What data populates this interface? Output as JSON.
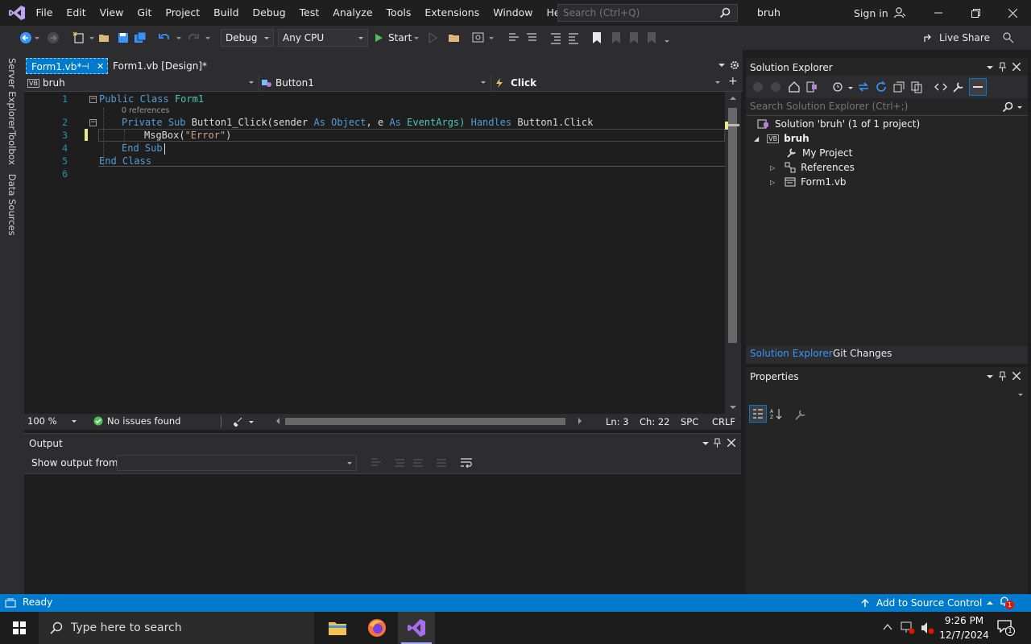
{
  "colors": {
    "accent": "#007acc",
    "editor_bg": "#1e1e1e",
    "chrome_bg": "#2d2d30",
    "keyword": "#569cd6",
    "type": "#4ec9b0",
    "string": "#d69d85",
    "line_number": "#2b91af"
  },
  "menu": [
    "File",
    "Edit",
    "View",
    "Git",
    "Project",
    "Build",
    "Debug",
    "Test",
    "Analyze",
    "Tools",
    "Extensions",
    "Window",
    "Help"
  ],
  "search": {
    "placeholder": "Search (Ctrl+Q)"
  },
  "solution_name": "bruh",
  "sign_in": "Sign in",
  "toolbar": {
    "config": "Debug",
    "platform": "Any CPU",
    "start": "Start",
    "live_share": "Live Share"
  },
  "side_tabs": [
    "Server Explorer",
    "Toolbox",
    "Data Sources"
  ],
  "doc_tabs": [
    {
      "label": "Form1.vb*",
      "pin": "⊣",
      "close": "✕"
    },
    {
      "label": "Form1.vb [Design]*"
    }
  ],
  "nav": {
    "project": "bruh",
    "object": "Button1",
    "event": "Click",
    "vb_badge": "VB"
  },
  "code": {
    "line_numbers": [
      "1",
      "2",
      "3",
      "4",
      "5",
      "6"
    ],
    "line1": {
      "kw1": "Public",
      "kw2": "Class",
      "name": "Form1"
    },
    "codelens": "0 references",
    "line2": {
      "kw1": "Private",
      "kw2": "Sub",
      "name": "Button1_Click(sender",
      "as1": "As",
      "t1": "Object",
      "mid": ", e",
      "as2": "As",
      "t2": "EventArgs)",
      "handles": "Handles",
      "target": "Button1.Click"
    },
    "line3": {
      "call": "MsgBox(",
      "str": "\"Error\"",
      "close": ")"
    },
    "line4": {
      "kw1": "End",
      "kw2": "Sub"
    },
    "line5": {
      "kw1": "End",
      "kw2": "Class"
    }
  },
  "editor_status": {
    "zoom": "100 %",
    "issues": "No issues found",
    "ln": "Ln: 3",
    "ch": "Ch: 22",
    "spc": "SPC",
    "crlf": "CRLF"
  },
  "output": {
    "title": "Output",
    "show_from": "Show output from:"
  },
  "solution_explorer": {
    "title": "Solution Explorer",
    "search_placeholder": "Search Solution Explorer (Ctrl+;)",
    "solution": "Solution 'bruh' (1 of 1 project)",
    "project": "bruh",
    "items": [
      "My Project",
      "References",
      "Form1.vb"
    ],
    "tab_active": "Solution Explorer",
    "tab_other": "Git Changes"
  },
  "properties": {
    "title": "Properties"
  },
  "statusbar": {
    "ready": "Ready",
    "source_control": "Add to Source Control",
    "notif_count": "1"
  },
  "taskbar": {
    "search": "Type here to search",
    "time": "9:26 PM",
    "date": "12/7/2024",
    "notif": "1"
  }
}
